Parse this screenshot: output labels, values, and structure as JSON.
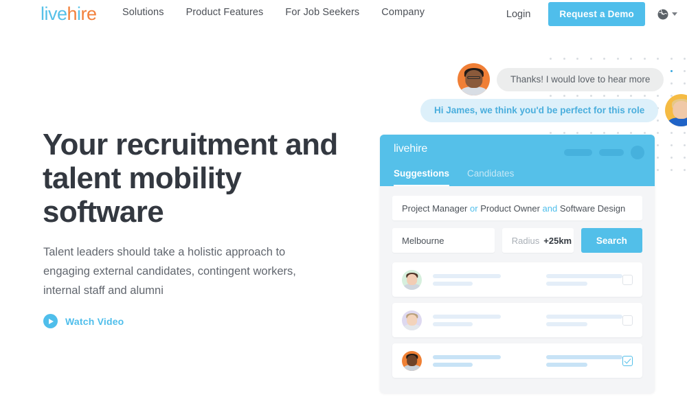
{
  "nav": {
    "logo": {
      "part1": "live",
      "part2": "h",
      "part3": "i",
      "part4": "re"
    },
    "links": [
      {
        "label": "Solutions"
      },
      {
        "label": "Product Features"
      },
      {
        "label": "For Job Seekers"
      },
      {
        "label": "Company"
      }
    ],
    "login_label": "Login",
    "demo_label": "Request a Demo",
    "language_icon": "globe-icon",
    "accent_color": "#4fbeeb"
  },
  "hero": {
    "title": "Your recruitment and talent mobility software",
    "subtitle": "Talent leaders should take a holistic approach to engaging external candidates, contingent workers, internal staff and alumni",
    "watch_video_label": "Watch Video",
    "play_icon": "play-circle-icon"
  },
  "chat": {
    "messages": [
      {
        "text": "Thanks! I would love to hear more",
        "side": "incoming",
        "avatar": "male-avatar"
      },
      {
        "text": "Hi James, we think you'd be perfect for this role",
        "side": "outgoing",
        "avatar": "female-avatar"
      }
    ],
    "bubble_gray": "#eceded",
    "bubble_blue": "#ddf0fa"
  },
  "app": {
    "logo": "livehire",
    "header_color": "#55c0e9",
    "tabs": [
      {
        "label": "Suggestions",
        "active": true
      },
      {
        "label": "Candidates",
        "active": false
      }
    ],
    "search": {
      "query_parts": [
        {
          "text": "Project Manager",
          "keyword": false
        },
        {
          "text": "or",
          "keyword": true
        },
        {
          "text": "Product Owner",
          "keyword": false
        },
        {
          "text": "and",
          "keyword": true
        },
        {
          "text": "Software Design",
          "keyword": false
        }
      ],
      "location_value": "Melbourne",
      "radius_label": "Radius",
      "radius_value": "+25km",
      "search_button": "Search"
    },
    "results": [
      {
        "avatar_color": "#d6efdd",
        "selected": false
      },
      {
        "avatar_color": "#ded9f0",
        "selected": false
      },
      {
        "avatar_color": "#ef8034",
        "selected": true
      }
    ]
  }
}
